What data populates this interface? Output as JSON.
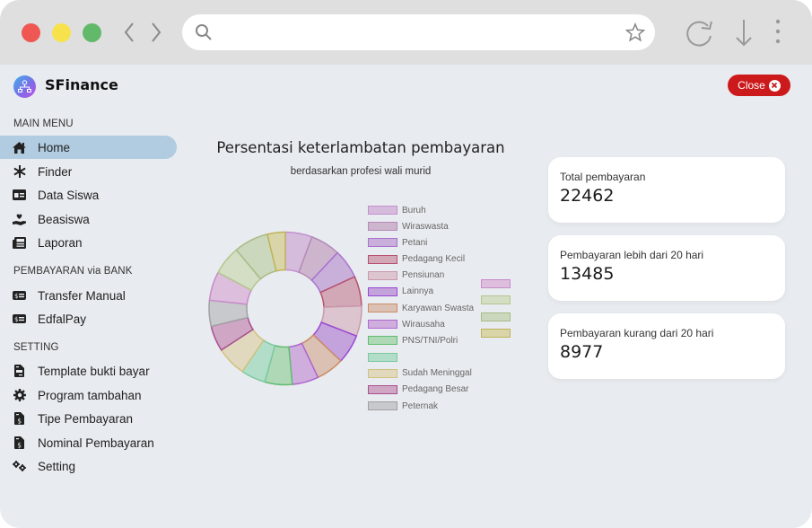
{
  "browser": {
    "url_value": "",
    "url_placeholder": ""
  },
  "app": {
    "brand": "SFinance",
    "close_label": "Close"
  },
  "sidebar": {
    "sections": [
      {
        "title": "MAIN MENU",
        "items": [
          {
            "label": "Home",
            "icon": "home-icon",
            "active": true
          },
          {
            "label": "Finder",
            "icon": "snowflake-icon"
          },
          {
            "label": "Data Siswa",
            "icon": "id-card-icon"
          },
          {
            "label": "Beasiswa",
            "icon": "hand-holding-heart-icon"
          },
          {
            "label": "Laporan",
            "icon": "newspaper-icon"
          }
        ]
      },
      {
        "title": "PEMBAYARAN via BANK",
        "items": [
          {
            "label": "Transfer Manual",
            "icon": "money-bill-icon"
          },
          {
            "label": "EdfalPay",
            "icon": "money-bill-icon"
          }
        ]
      },
      {
        "title": "SETTING",
        "items": [
          {
            "label": "Template bukti bayar",
            "icon": "file-invoice-icon"
          },
          {
            "label": "Program tambahan",
            "icon": "cog-icon"
          },
          {
            "label": "Tipe Pembayaran",
            "icon": "file-invoice-dollar-icon"
          },
          {
            "label": "Nominal Pembayaran",
            "icon": "file-invoice-dollar-icon"
          },
          {
            "label": "Setting",
            "icon": "cogs-icon"
          }
        ]
      }
    ]
  },
  "stats": [
    {
      "label": "Total pembayaran",
      "value": "22462"
    },
    {
      "label": "Pembayaran lebih dari 20 hari",
      "value": "13485"
    },
    {
      "label": "Pembayaran kurang dari 20 hari",
      "value": "8977"
    }
  ],
  "chart_data": {
    "type": "pie",
    "variant": "doughnut",
    "title": "Persentasi keterlambatan pembayaran",
    "subtitle": "berdasarkan profesi wali murid",
    "legend_position": "right",
    "unit": "percent (estimated from slice angles)",
    "slices": [
      {
        "label": "Buruh",
        "value": 5.7,
        "fill": "#d5bcdc",
        "border": "#c48fd0"
      },
      {
        "label": "Wiraswasta",
        "value": 6.3,
        "fill": "#cdb6cd",
        "border": "#b68ab9"
      },
      {
        "label": "Petani",
        "value": 6.2,
        "fill": "#c8b0da",
        "border": "#a872cf"
      },
      {
        "label": "Pedagang Kecil",
        "value": 6.3,
        "fill": "#d2a8b7",
        "border": "#b8506f"
      },
      {
        "label": "Pensiunan",
        "value": 6.4,
        "fill": "#dcc5ce",
        "border": "#c99aab"
      },
      {
        "label": "Lainnya",
        "value": 6.2,
        "fill": "#c4a2dc",
        "border": "#9b48d4"
      },
      {
        "label": "Karyawan Swasta",
        "value": 5.9,
        "fill": "#dbc1b4",
        "border": "#cc8d65"
      },
      {
        "label": "Wirausaha",
        "value": 5.6,
        "fill": "#cfaedd",
        "border": "#af66d0"
      },
      {
        "label": "PNS/TNI/Polri",
        "value": 5.8,
        "fill": "#afd9b6",
        "border": "#63bc72"
      },
      {
        "label": "",
        "value": 5.2,
        "fill": "#b2dec9",
        "border": "#7dc9a0"
      },
      {
        "label": "Sudah Meninggal",
        "value": 6.3,
        "fill": "#e0d9be",
        "border": "#d1c280"
      },
      {
        "label": "Pedagang Besar",
        "value": 5.4,
        "fill": "#cfa7c5",
        "border": "#a8508f"
      },
      {
        "label": "Peternak",
        "value": 5.5,
        "fill": "#c8c9cc",
        "border": "#a0a0a5"
      },
      {
        "label": "",
        "value": 6.1,
        "fill": "#ddbedc",
        "border": "#c98bcb"
      },
      {
        "label": "",
        "value": 6.1,
        "fill": "#d3dec5",
        "border": "#b4c68e"
      },
      {
        "label": "",
        "value": 7.3,
        "fill": "#ccd8bd",
        "border": "#a9bb86"
      },
      {
        "label": "",
        "value": 3.8,
        "fill": "#d9d5a9",
        "border": "#bfb45a"
      }
    ]
  }
}
